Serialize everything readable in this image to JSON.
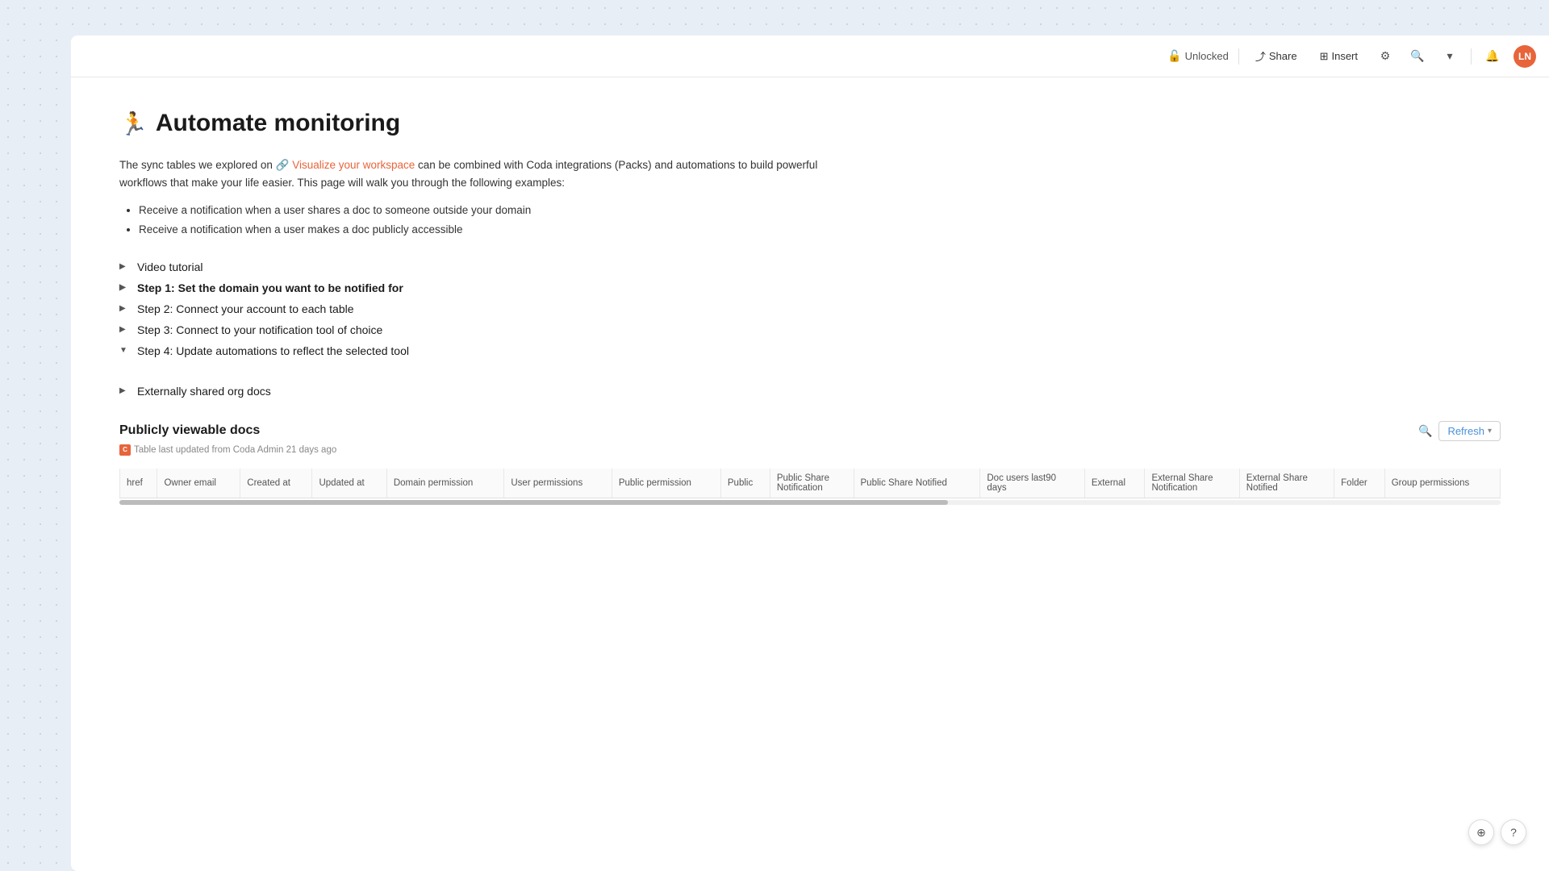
{
  "topbar": {
    "unlocked_label": "Unlocked",
    "share_label": "Share",
    "insert_label": "Insert",
    "avatar_initials": "LN",
    "avatar_bg": "#e8643a"
  },
  "page": {
    "emoji": "🏃",
    "title": "Automate monitoring",
    "intro_before_link": "The sync tables we explored on ",
    "intro_link_text": "Visualize your workspace",
    "intro_after_link": " can be combined with Coda integrations (Packs) and automations to build powerful workflows that make your life easier. This page will walk you through the following examples:",
    "bullets": [
      "Receive a notification when a user shares a doc to someone outside your domain",
      "Receive a notification when a user makes a doc publicly accessible"
    ]
  },
  "collapsible_sections": [
    {
      "label": "Video tutorial",
      "collapsed": true
    },
    {
      "label": "Step 1: Set the domain you want to be notified for",
      "collapsed": true,
      "bold": true
    },
    {
      "label": "Step 2: Connect your account to each table",
      "collapsed": true,
      "bold": false
    },
    {
      "label": "Step 3: Connect to your notification tool of choice",
      "collapsed": true,
      "bold": false
    },
    {
      "label": "Step 4: Update automations to reflect the selected tool",
      "collapsed": false,
      "bold": false
    }
  ],
  "externally_shared": {
    "label": "Externally shared org docs"
  },
  "publicly_viewable": {
    "title": "Publicly viewable docs",
    "meta_text": "Table last updated from Coda Admin 21 days ago",
    "refresh_label": "Refresh",
    "columns": [
      "href",
      "Owner email",
      "Created at",
      "Updated at",
      "Domain permission",
      "User permissions",
      "Public permission",
      "Public",
      "Public Share Notification",
      "Public Share Notified",
      "Doc users last90 days",
      "External",
      "External Share Notification",
      "External Share Notified",
      "Folder",
      "Group permissions"
    ]
  },
  "bottom_buttons": {
    "help_label": "?",
    "navigate_label": "⊕"
  }
}
